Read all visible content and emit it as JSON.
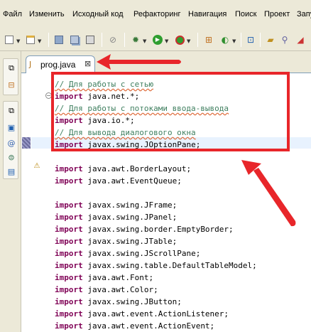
{
  "menu": [
    {
      "name": "menu-file",
      "label": "Файл"
    },
    {
      "name": "menu-edit",
      "label": "Изменить"
    },
    {
      "name": "menu-source",
      "label": "Исходный код"
    },
    {
      "name": "menu-refactor",
      "label": "Рефакторинг"
    },
    {
      "name": "menu-navigate",
      "label": "Навигация"
    },
    {
      "name": "menu-search",
      "label": "Поиск"
    },
    {
      "name": "menu-project",
      "label": "Проект"
    },
    {
      "name": "menu-run",
      "label": "Запу"
    }
  ],
  "toolbar": {
    "icons": [
      "new-icon",
      "new-class-icon",
      "save-icon",
      "save-all-icon",
      "print-icon",
      "skip-breakpoints-icon",
      "debug-icon",
      "run-icon",
      "run-external-icon",
      "new-package-icon",
      "new-project-icon",
      "open-type-icon",
      "search-icon",
      "open-folder-icon",
      "annotation-icon"
    ]
  },
  "editor": {
    "tab_label": "prog.java",
    "tab_close_glyph": "⊠",
    "lines": [
      {
        "type": "comment",
        "text": "// Для работы с сетью"
      },
      {
        "type": "import",
        "keyword": "import",
        "rest": " java.net.*;"
      },
      {
        "type": "comment",
        "text": "// Для работы с потоками ввода-вывода"
      },
      {
        "type": "import",
        "keyword": "import",
        "rest": " java.io.*;"
      },
      {
        "type": "comment",
        "text": "// Для вывода диалогового окна"
      },
      {
        "type": "import",
        "keyword": "import",
        "rest": " javax.swing.JOptionPane;"
      },
      {
        "type": "blank"
      },
      {
        "type": "import",
        "keyword": "import",
        "rest": " java.awt.BorderLayout;"
      },
      {
        "type": "import",
        "keyword": "import",
        "rest": " java.awt.EventQueue;"
      },
      {
        "type": "blank"
      },
      {
        "type": "import",
        "keyword": "import",
        "rest": " javax.swing.JFrame;"
      },
      {
        "type": "import",
        "keyword": "import",
        "rest": " javax.swing.JPanel;"
      },
      {
        "type": "import",
        "keyword": "import",
        "rest": " javax.swing.border.EmptyBorder;"
      },
      {
        "type": "import",
        "keyword": "import",
        "rest": " javax.swing.JTable;"
      },
      {
        "type": "import",
        "keyword": "import",
        "rest": " javax.swing.JScrollPane;"
      },
      {
        "type": "import",
        "keyword": "import",
        "rest": " javax.swing.table.DefaultTableModel;"
      },
      {
        "type": "import",
        "keyword": "import",
        "rest": " java.awt.Font;"
      },
      {
        "type": "import",
        "keyword": "import",
        "rest": " java.awt.Color;"
      },
      {
        "type": "import",
        "keyword": "import",
        "rest": " javax.swing.JButton;"
      },
      {
        "type": "import",
        "keyword": "import",
        "rest": " java.awt.event.ActionListener;"
      },
      {
        "type": "import",
        "keyword": "import",
        "rest": " java.awt.event.ActionEvent;"
      }
    ]
  },
  "colors": {
    "keyword": "#7f0055",
    "comment": "#3f7f5f",
    "annotation": "#e8262a",
    "chrome": "#ece9d8"
  }
}
